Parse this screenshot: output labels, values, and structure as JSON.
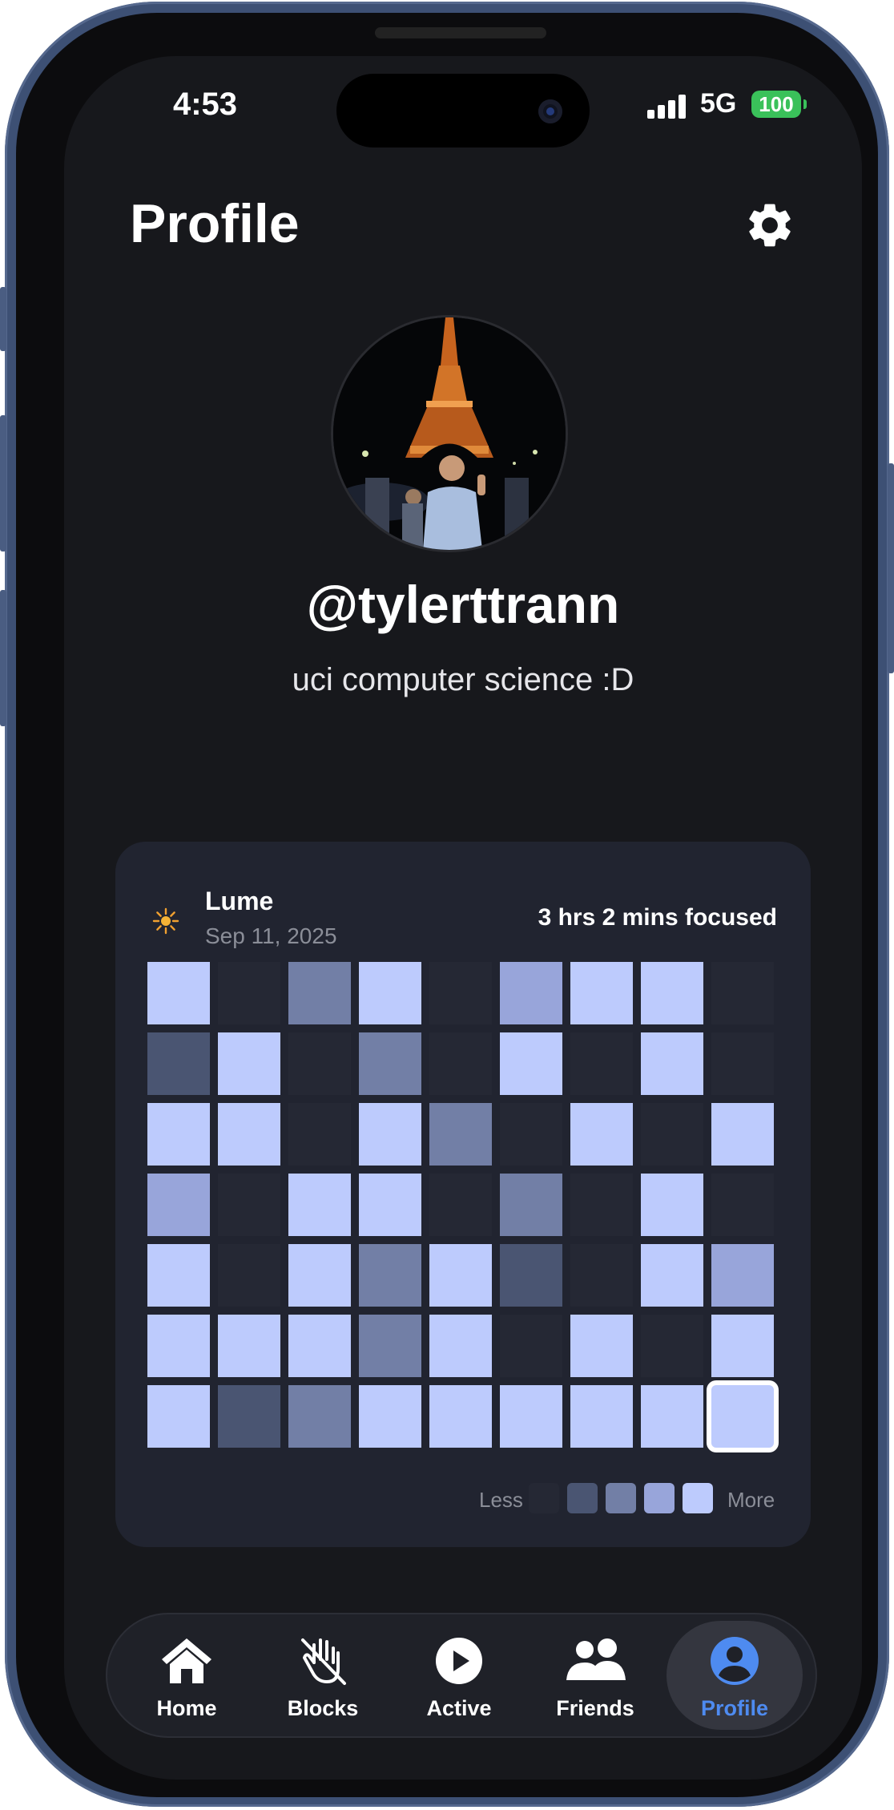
{
  "status_bar": {
    "time": "4:53",
    "network": "5G",
    "battery": "100"
  },
  "header": {
    "title": "Profile"
  },
  "profile": {
    "username": "@tylerttrann",
    "bio": "uci computer science :D"
  },
  "focus_card": {
    "app_name": "Lume",
    "date": "Sep 11, 2025",
    "summary": "3 hrs 2 mins focused",
    "heatmap_levels": [
      [
        4,
        0,
        2,
        4,
        0,
        3,
        4,
        4,
        0
      ],
      [
        1,
        4,
        0,
        2,
        0,
        4,
        0,
        4,
        0
      ],
      [
        4,
        4,
        0,
        4,
        2,
        0,
        4,
        0,
        4
      ],
      [
        3,
        0,
        4,
        4,
        0,
        2,
        0,
        4,
        0
      ],
      [
        4,
        0,
        4,
        2,
        4,
        1,
        0,
        4,
        3
      ],
      [
        4,
        4,
        4,
        2,
        4,
        0,
        4,
        0,
        4
      ],
      [
        4,
        1,
        2,
        4,
        4,
        4,
        4,
        4,
        4
      ]
    ],
    "level_colors": [
      "#252834",
      "#4a5572",
      "#727fa6",
      "#98a5da",
      "#bdcbfd"
    ],
    "legend": {
      "less": "Less",
      "more": "More"
    }
  },
  "tab_bar": {
    "tabs": [
      {
        "label": "Home",
        "icon": "home-icon"
      },
      {
        "label": "Blocks",
        "icon": "blocked-hand-icon"
      },
      {
        "label": "Active",
        "icon": "play-icon"
      },
      {
        "label": "Friends",
        "icon": "friends-icon"
      },
      {
        "label": "Profile",
        "icon": "profile-icon",
        "active": true
      }
    ]
  }
}
